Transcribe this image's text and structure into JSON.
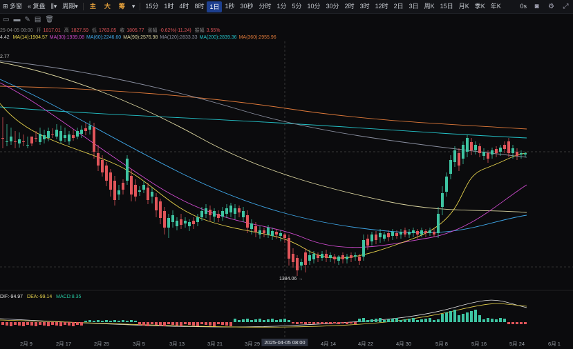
{
  "toolbar": {
    "panes": "多窗",
    "replay": "复盘",
    "period": "周期",
    "zh_main": "主",
    "zh_big": "大",
    "zh_chip": "筹",
    "intervals": [
      "15分",
      "1时",
      "4时",
      "8时",
      "1日",
      "1秒",
      "30秒",
      "分时",
      "1分",
      "5分",
      "10分",
      "30分",
      "2时",
      "3时",
      "12时",
      "2日",
      "3日",
      "周K",
      "15日",
      "月K",
      "季K",
      "年K"
    ],
    "active_interval": "1日",
    "right_text": "0s"
  },
  "ohlc": {
    "date": "25-04-05 08:00",
    "open_label": "开",
    "open": "1817.01",
    "high_label": "高",
    "high": "1827.59",
    "low_label": "低",
    "low": "1763.05",
    "close_label": "收",
    "close": "1805.77",
    "change_label": "涨幅",
    "change": "-0.62%(-11.24)",
    "amp_label": "振幅",
    "amp": "3.55%"
  },
  "ma": {
    "first": "4.42",
    "items": [
      {
        "label": "MA(14):1904.57",
        "color": "#e8d44d"
      },
      {
        "label": "MA(30):1939.08",
        "color": "#d04bd0"
      },
      {
        "label": "MA(60):2246.60",
        "color": "#3fa7e8"
      },
      {
        "label": "MA(90):2576.98",
        "color": "#dcd6a0"
      },
      {
        "label": "MA(120):2833.33",
        "color": "#8a8fa0"
      },
      {
        "label": "MA(200):2839.36",
        "color": "#24c3c9"
      },
      {
        "label": "MA(360):2955.96",
        "color": "#e07a3a"
      }
    ]
  },
  "price_tag": "2.77",
  "low_label": "1384.06",
  "macd": {
    "dif": "DIF:-94.97",
    "dea": "DEA:-99.14",
    "macd": "MACD:8.35",
    "dif_color": "#e6e6e6",
    "dea_color": "#e8d44d",
    "macd_color": "#26c6a0"
  },
  "colors": {
    "up": "#3ec4a2",
    "down": "#e0555a"
  },
  "chart_data": {
    "type": "candlestick",
    "x_ticks": [
      "2月 9",
      "2月 17",
      "2月 25",
      "3月 5",
      "3月 13",
      "3月 21",
      "3月 29",
      "4月 14",
      "4月 22",
      "4月 30",
      "5月 8",
      "5月 16",
      "5月 24",
      "6月 1"
    ],
    "crosshair_label": "2025-04-05 08:00",
    "ylim": [
      1250,
      3350
    ]
  }
}
